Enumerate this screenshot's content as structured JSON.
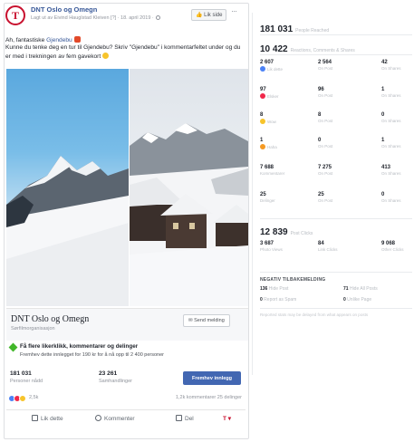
{
  "post": {
    "page_name": "DNT Oslo og Omegn",
    "meta": "Lagt ut av Eivind Hauglstad Kleiven [?] · 18. april 2019 ·",
    "like_page_label": "Lik side",
    "text_line1_prefix": "Ah, fantastiske ",
    "text_link": "Gjendebu",
    "text_line2": "Kunne du tenke deg en tur til Gjendebu? Skriv \"Gjendebu\" i kommentarfeltet under og du er med i trekningen av fem gavekort",
    "advertiser_name": "DNT Oslo og Omegn",
    "advertiser_sub": "Sørfilmorganisasjon",
    "send_message_label": "Send melding",
    "boost_title": "Få flere likerklikk, kommentarer og delinger",
    "boost_desc": "Fremhev dette innlegget for 190 kr for å nå opp til 2 400 personer",
    "reach_value": "181 031",
    "reach_label": "Personer nådd",
    "engagement_value": "23 261",
    "engagement_label": "Samhandlinger",
    "promote_label": "Fremhev innlegg",
    "reactions_count": "2,5k",
    "comments_shares": "1,2k kommentarer  25 delinger",
    "action_like": "Lik dette",
    "action_comment": "Kommenter",
    "action_share": "Del"
  },
  "stats": {
    "people_reached": "181 031",
    "people_reached_label": "People Reached",
    "reactions_total": "10 422",
    "reactions_total_label": "Reactions, Comments & Shares",
    "rows": [
      [
        {
          "value": "2 607",
          "label": "Lik dette",
          "icon": "like"
        },
        {
          "value": "2 564",
          "label": "On Post"
        },
        {
          "value": "42",
          "label": "On Shares"
        }
      ],
      [
        {
          "value": "97",
          "label": "Elsker",
          "icon": "love"
        },
        {
          "value": "96",
          "label": "On Post"
        },
        {
          "value": "1",
          "label": "On Shares"
        }
      ],
      [
        {
          "value": "8",
          "label": "Wow",
          "icon": "wow"
        },
        {
          "value": "8",
          "label": "On Post"
        },
        {
          "value": "0",
          "label": "On Shares"
        }
      ],
      [
        {
          "value": "1",
          "label": "Haha",
          "icon": "haha"
        },
        {
          "value": "0",
          "label": "On Post"
        },
        {
          "value": "1",
          "label": "On Shares"
        }
      ],
      [
        {
          "value": "7 688",
          "label": "Kommentarer"
        },
        {
          "value": "7 275",
          "label": "On Post"
        },
        {
          "value": "413",
          "label": "On Shares"
        }
      ],
      [
        {
          "value": "25",
          "label": "Delinger"
        },
        {
          "value": "25",
          "label": "On Post"
        },
        {
          "value": "0",
          "label": "On Shares"
        }
      ]
    ],
    "post_clicks": "12 839",
    "post_clicks_label": "Post Clicks",
    "clicks": [
      {
        "value": "3 687",
        "label": "Photo Views"
      },
      {
        "value": "84",
        "label": "Link Clicks"
      },
      {
        "value": "9 068",
        "label": "Other Clicks"
      }
    ],
    "negative_title": "NEGATIV TILBAKEMELDING",
    "negative": [
      {
        "value": "136",
        "label": "Hide Post"
      },
      {
        "value": "71",
        "label": "Hide All Posts"
      },
      {
        "value": "0",
        "label": "Report as Spam"
      },
      {
        "value": "0",
        "label": "Unlike Page"
      }
    ],
    "footnote": "Reported stats may be delayed from what appears on posts"
  }
}
